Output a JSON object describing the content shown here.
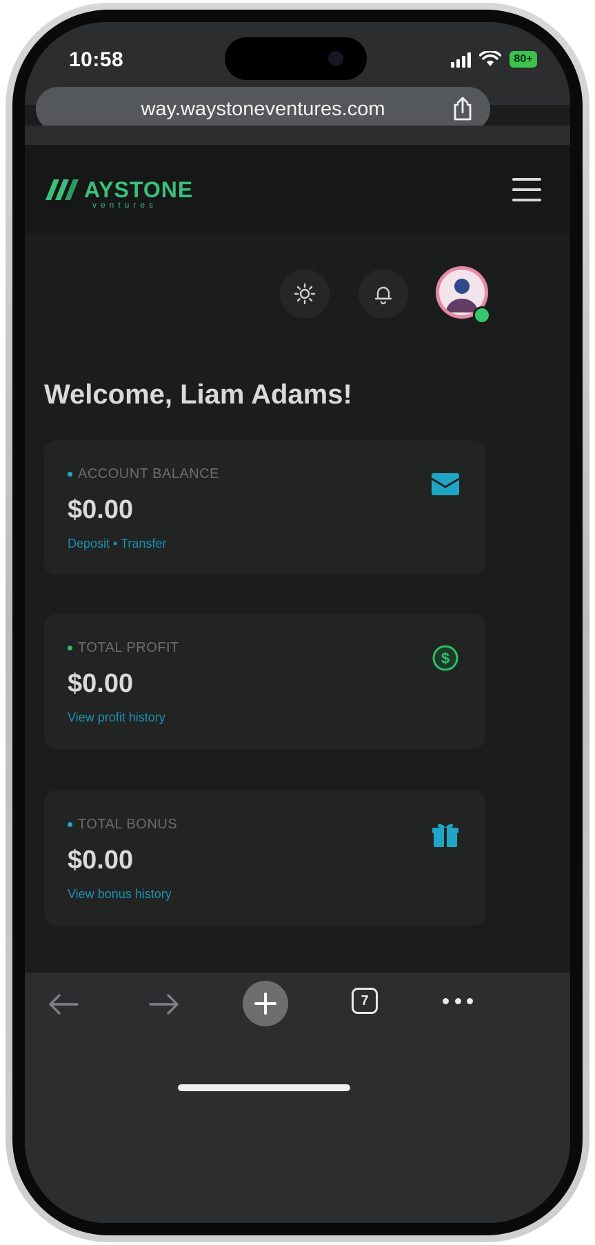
{
  "status_bar": {
    "time": "10:58",
    "battery": "80+",
    "battery_color": "#3cc34c"
  },
  "browser": {
    "url": "way.waystoneventures.com",
    "tab_count": "7"
  },
  "brand": {
    "accent": "#3bbf7b",
    "link_color": "#1e8fb0",
    "logo_alt_text": "WAYSTONE ventures"
  },
  "header": {
    "menu_icon": "hamburger-icon",
    "theme_icon": "sun-icon",
    "notification_icon": "bell-icon"
  },
  "welcome": {
    "text": "Welcome, Liam Adams!"
  },
  "cards": [
    {
      "label": "ACCOUNT BALANCE",
      "value": "$0.00",
      "link": "Deposit • Transfer",
      "icon": "wallet-icon",
      "icon_color": "#1ea6c4",
      "dot_color": "#1ea6c4"
    },
    {
      "label": "TOTAL PROFIT",
      "value": "$0.00",
      "link": "View profit history",
      "icon": "dollar-icon",
      "icon_color": "#2fbf66",
      "dot_color": "#2fbf66"
    },
    {
      "label": "TOTAL BONUS",
      "value": "$0.00",
      "link": "View bonus history",
      "icon": "gift-icon",
      "icon_color": "#1ea6c4",
      "dot_color": "#1ea6c4"
    }
  ]
}
